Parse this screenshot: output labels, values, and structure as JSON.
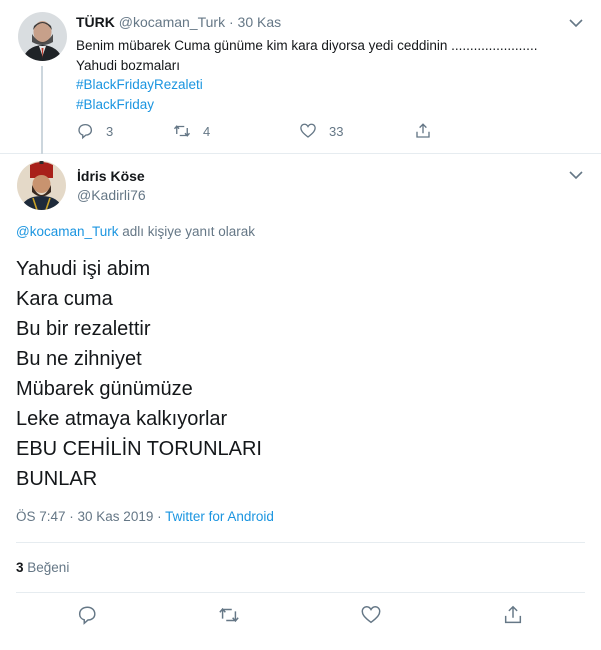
{
  "reply_tweet": {
    "display_name": "TÜRK",
    "handle": "@kocaman_Turk",
    "separator": "·",
    "date": "30 Kas",
    "body_lines": [
      "Benim mübarek Cuma günüme kim kara diyorsa yedi ceddinin .......................",
      "Yahudi bozmaları"
    ],
    "hashtags": [
      "#BlackFridayRezaleti",
      "#BlackFriday"
    ],
    "reply_count": "3",
    "retweet_count": "4",
    "like_count": "33"
  },
  "main_tweet": {
    "display_name": "İdris Köse",
    "handle": "@Kadirli76",
    "replying_to_handle": "@kocaman_Turk",
    "replying_to_suffix": " adlı kişiye yanıt olarak",
    "text_lines": [
      "Yahudi işi abim",
      "Kara cuma",
      "Bu bir rezalettir",
      "Bu ne zihniyet",
      "Mübarek günümüze",
      "Leke atmaya kalkıyorlar",
      "EBU CEHİLİN TORUNLARI",
      "BUNLAR"
    ],
    "timestamp": "ÖS 7:47 · 30 Kas 2019",
    "meta_separator": " · ",
    "source": "Twitter for Android",
    "like_count": "3",
    "like_label": "Beğeni"
  },
  "colors": {
    "link": "#1b95e0",
    "muted": "#657786",
    "text": "#14171a",
    "border": "#e6ecf0"
  },
  "icons": [
    "avatar",
    "chevron-down-icon",
    "reply-icon",
    "retweet-icon",
    "like-icon",
    "share-icon"
  ]
}
